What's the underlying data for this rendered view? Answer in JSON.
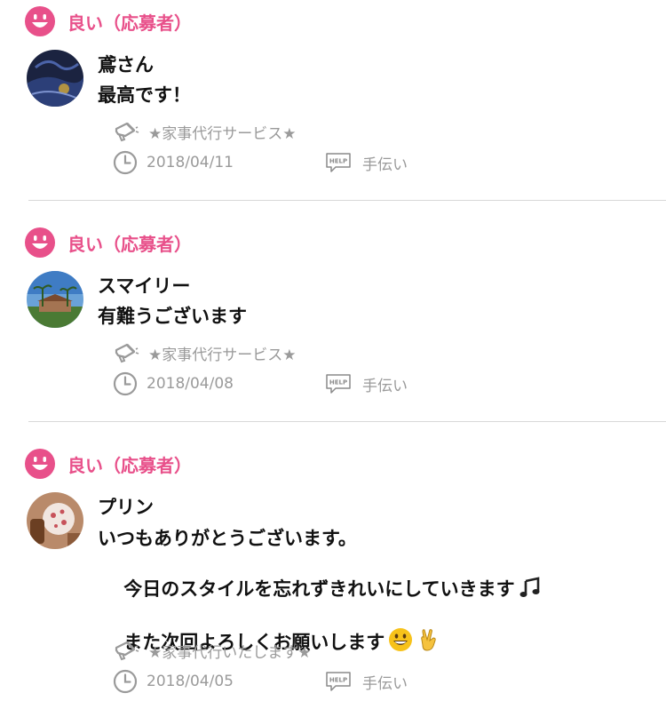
{
  "colors": {
    "accent": "#e8508a",
    "meta_gray": "#9a9a9a",
    "divider": "#d8d8d8"
  },
  "reviews": [
    {
      "rating_label": "良い（応募者）",
      "user_name": "鳶さん",
      "comment": "最高です！",
      "service_title": "★家事代行サービス★",
      "date": "2018/04/11",
      "category": "手伝い"
    },
    {
      "rating_label": "良い（応募者）",
      "user_name": "スマイリー",
      "comment": "有難うございます",
      "service_title": "★家事代行サービス★",
      "date": "2018/04/08",
      "category": "手伝い"
    },
    {
      "rating_label": "良い（応募者）",
      "user_name": "プリン",
      "comment_line1": "いつもありがとうございます。",
      "comment_line2": "今日のスタイルを忘れずきれいにしていきます",
      "comment_line3": "また次回よろしくお願いします",
      "service_title": "★家事代行いたします★",
      "date": "2018/04/05",
      "category": "手伝い"
    }
  ],
  "icons": {
    "rating": "smiley-face-icon",
    "service": "megaphone-icon",
    "date": "clock-icon",
    "category": "help-tag-icon",
    "emoji_music": "music-notes-icon",
    "emoji_smile": "grinning-face-icon",
    "emoji_victory": "victory-hand-icon"
  }
}
